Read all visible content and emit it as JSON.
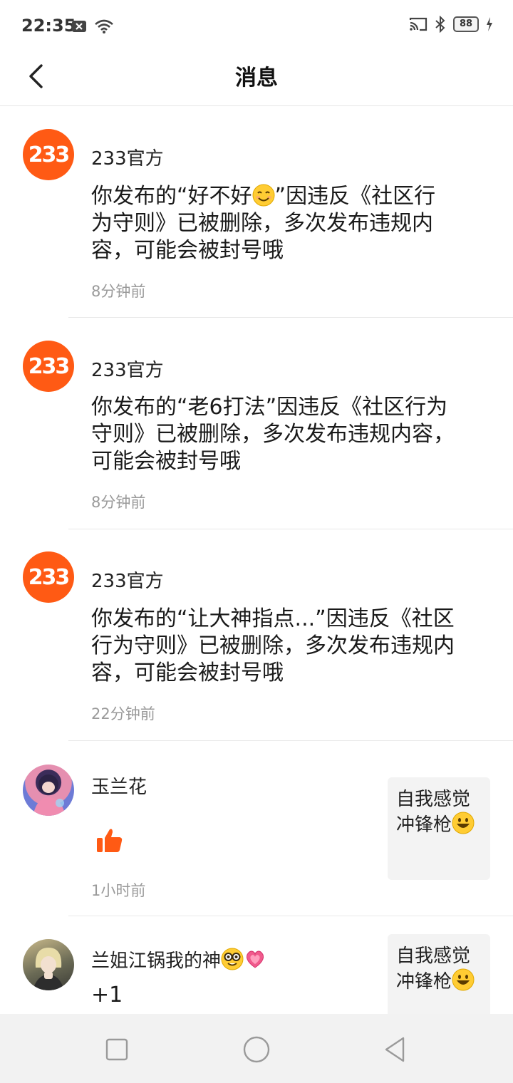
{
  "status_bar": {
    "time": "22:35",
    "battery": "88"
  },
  "header": {
    "title": "消息"
  },
  "messages": [
    {
      "sender": "233官方",
      "avatar_text": "233",
      "text_before": "你发布的“好不好",
      "emoji": "smiling-face",
      "text_after": "”因违反《社区行为守则》已被删除，多次发布违规内容，可能会被封号哦",
      "time": "8分钟前"
    },
    {
      "sender": "233官方",
      "avatar_text": "233",
      "text": "你发布的“老6打法”因违反《社区行为守则》已被删除，多次发布违规内容，可能会被封号哦",
      "time": "8分钟前"
    },
    {
      "sender": "233官方",
      "avatar_text": "233",
      "text": "你发布的“让大神指点...”因违反《社区行为守则》已被删除，多次发布违规内容，可能会被封号哦",
      "time": "22分钟前"
    },
    {
      "sender": "玉兰花",
      "time": "1小时前",
      "reaction": "thumbs-up",
      "post_preview": "自我感觉冲锋枪"
    },
    {
      "sender": "兰姐江锅我的神",
      "sender_emojis": [
        "nerd-face",
        "sparkling-heart"
      ],
      "text": "+1",
      "post_preview": "自我感觉冲锋枪"
    }
  ],
  "colors": {
    "brand_orange": "#ff5a14",
    "time_gray": "#9a9a9a"
  }
}
